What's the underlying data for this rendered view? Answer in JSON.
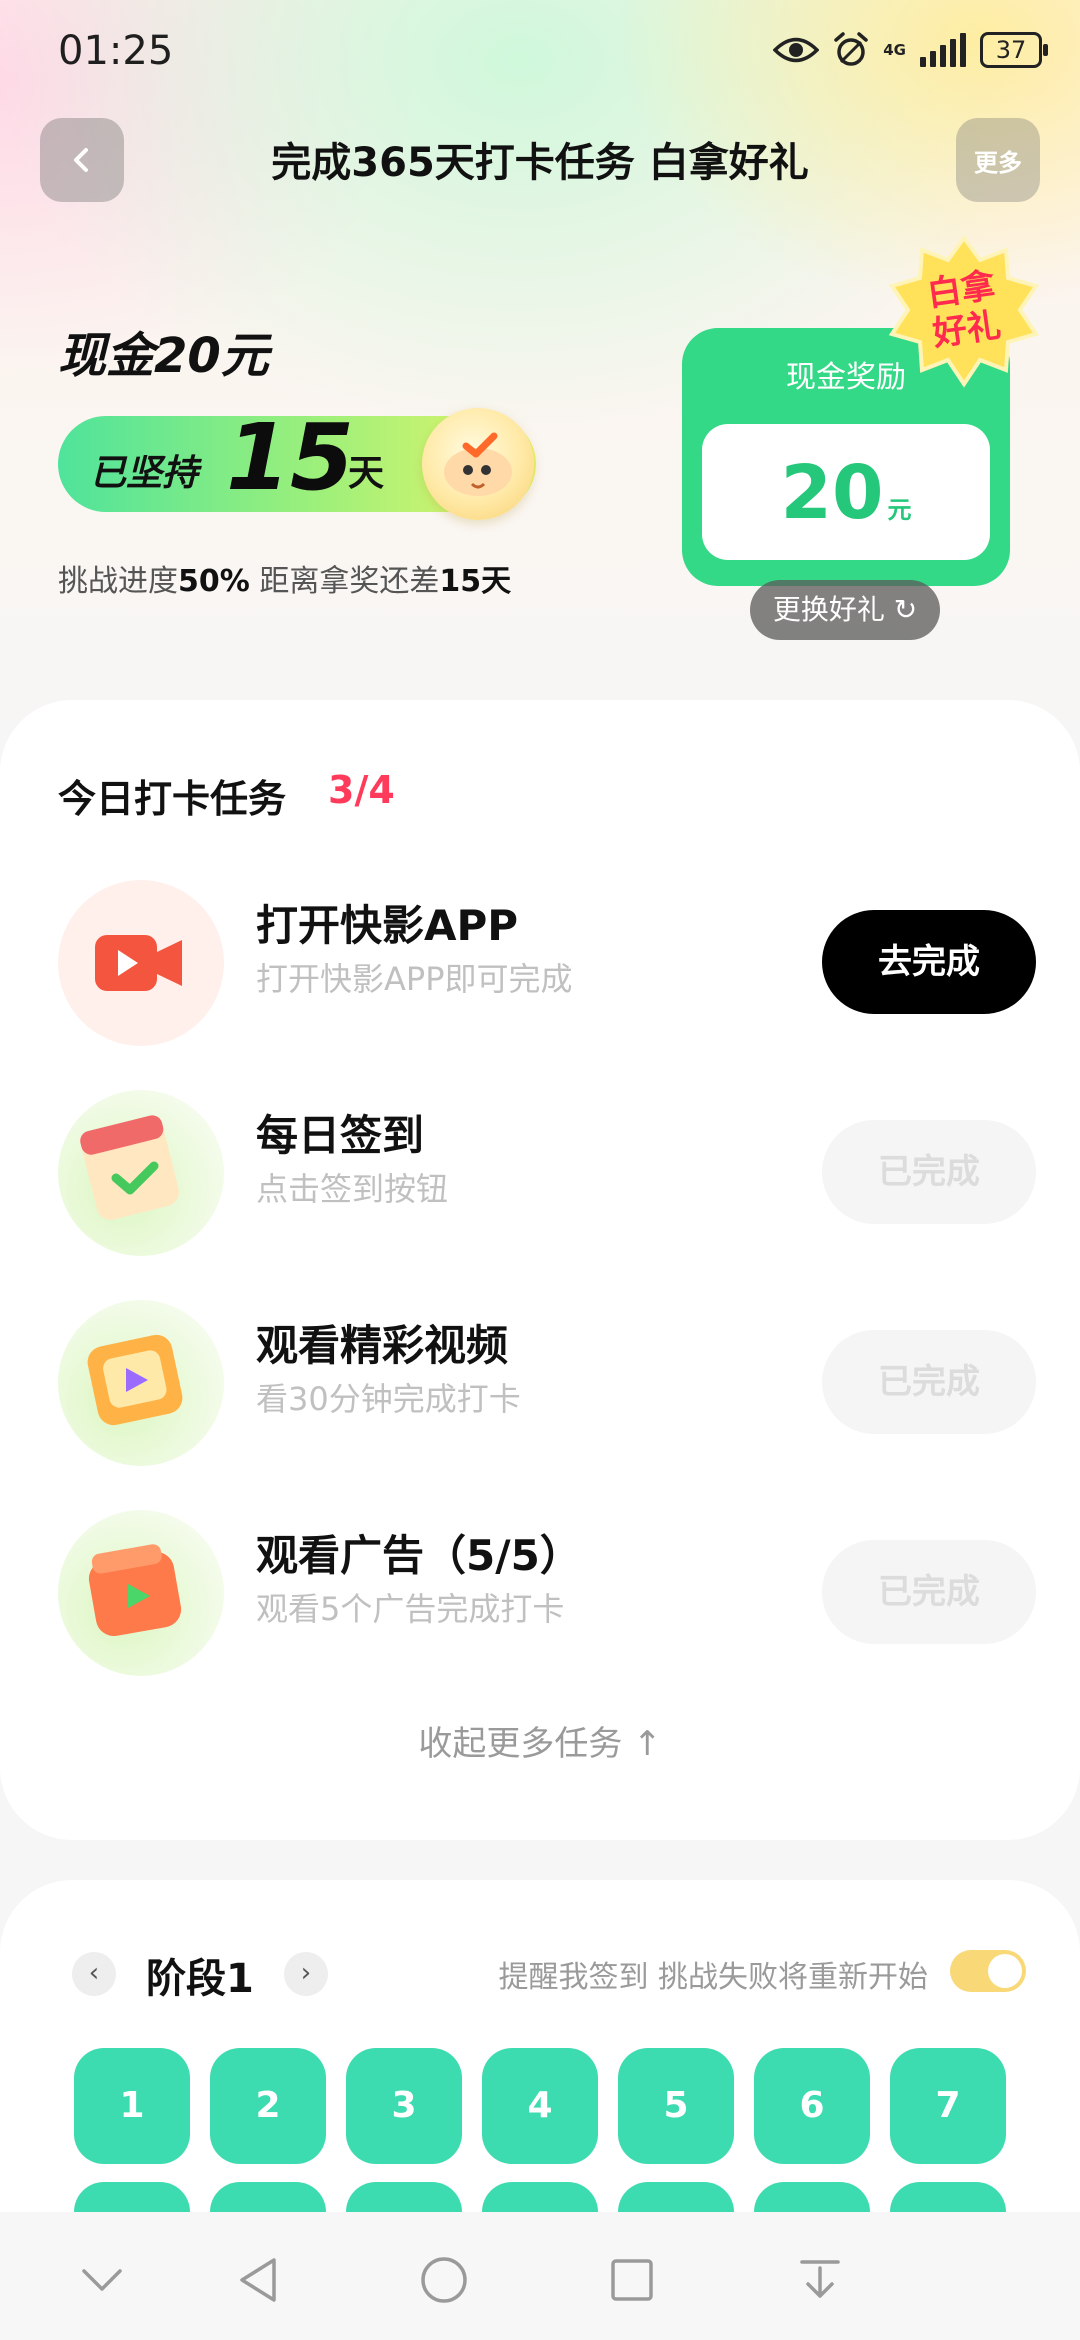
{
  "status_bar": {
    "time": "01:25",
    "network": "4G",
    "battery": "37"
  },
  "header": {
    "title": "完成365天打卡任务 白拿好礼",
    "more_label": "更多"
  },
  "hero": {
    "reward_name": "现金20元",
    "streak_label": "已坚持",
    "streak_days": "15",
    "streak_unit": "天",
    "progress_prefix": "挑战进度",
    "progress_value": "50%",
    "progress_middle": " 距离拿奖还差",
    "remaining_days": "15天",
    "cash_card": {
      "title": "现金奖励",
      "amount": "20",
      "unit": "元"
    },
    "badge": {
      "line1": "白拿",
      "line2": "好礼"
    },
    "swap_label": "更换好礼 ↻"
  },
  "tasks": {
    "heading": "今日打卡任务",
    "count": "3/4",
    "items": [
      {
        "title": "打开快影APP",
        "subtitle": "打开快影APP即可完成",
        "button": "去完成",
        "icon": "video-camera-icon"
      },
      {
        "title": "每日签到",
        "subtitle": "点击签到按钮",
        "button": "已完成",
        "icon": "calendar-check-icon"
      },
      {
        "title": "观看精彩视频",
        "subtitle": "看30分钟完成打卡",
        "button": "已完成",
        "icon": "video-play-icon"
      },
      {
        "title": "观看广告（5/5）",
        "subtitle": "观看5个广告完成打卡",
        "button": "已完成",
        "icon": "ad-play-icon"
      }
    ],
    "collapse_label": "收起更多任务 ↑"
  },
  "stage": {
    "title": "阶段1",
    "hint": "提醒我签到 挑战失败将重新开始",
    "reminder_on": true,
    "days": [
      "1",
      "2",
      "3",
      "4",
      "5",
      "6",
      "7"
    ]
  },
  "colors": {
    "accent_green": "#34d987",
    "day_cell": "#3ddbb0",
    "count_red": "#ff3b5c"
  }
}
